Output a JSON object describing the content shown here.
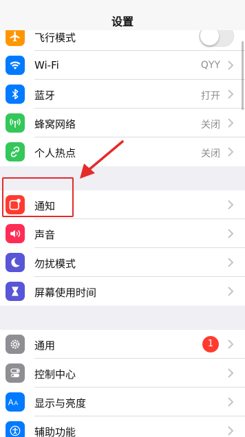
{
  "nav": {
    "title": "设置"
  },
  "group1": [
    {
      "name": "airplane-mode",
      "label": "飞行模式",
      "icon": "airplane-icon",
      "color": "#ff9500",
      "toggle": false
    },
    {
      "name": "wifi",
      "label": "Wi-Fi",
      "value": "QYY",
      "icon": "wifi-icon",
      "color": "#007aff"
    },
    {
      "name": "bluetooth",
      "label": "蓝牙",
      "value": "打开",
      "icon": "bluetooth-icon",
      "color": "#007aff"
    },
    {
      "name": "cellular",
      "label": "蜂窝网络",
      "value": "关闭",
      "icon": "antenna-icon",
      "color": "#34c759"
    },
    {
      "name": "hotspot",
      "label": "个人热点",
      "value": "关闭",
      "icon": "link-icon",
      "color": "#34c759"
    }
  ],
  "group2": [
    {
      "name": "notifications",
      "label": "通知",
      "icon": "notification-icon",
      "color": "#ff3b30"
    },
    {
      "name": "sounds",
      "label": "声音",
      "icon": "speaker-icon",
      "color": "#ff2d55"
    },
    {
      "name": "do-not-disturb",
      "label": "勿扰模式",
      "icon": "moon-icon",
      "color": "#5856d6"
    },
    {
      "name": "screen-time",
      "label": "屏幕使用时间",
      "icon": "hourglass-icon",
      "color": "#5856d6"
    }
  ],
  "group3": [
    {
      "name": "general",
      "label": "通用",
      "badge": "1",
      "icon": "gear-icon",
      "color": "#8e8e93"
    },
    {
      "name": "control-center",
      "label": "控制中心",
      "icon": "switches-icon",
      "color": "#8e8e93"
    },
    {
      "name": "display",
      "label": "显示与亮度",
      "icon": "text-size-icon",
      "color": "#007aff"
    },
    {
      "name": "accessibility",
      "label": "辅助功能",
      "icon": "accessibility-icon",
      "color": "#007aff"
    }
  ],
  "annotation": {
    "color": "#e52a2a"
  }
}
